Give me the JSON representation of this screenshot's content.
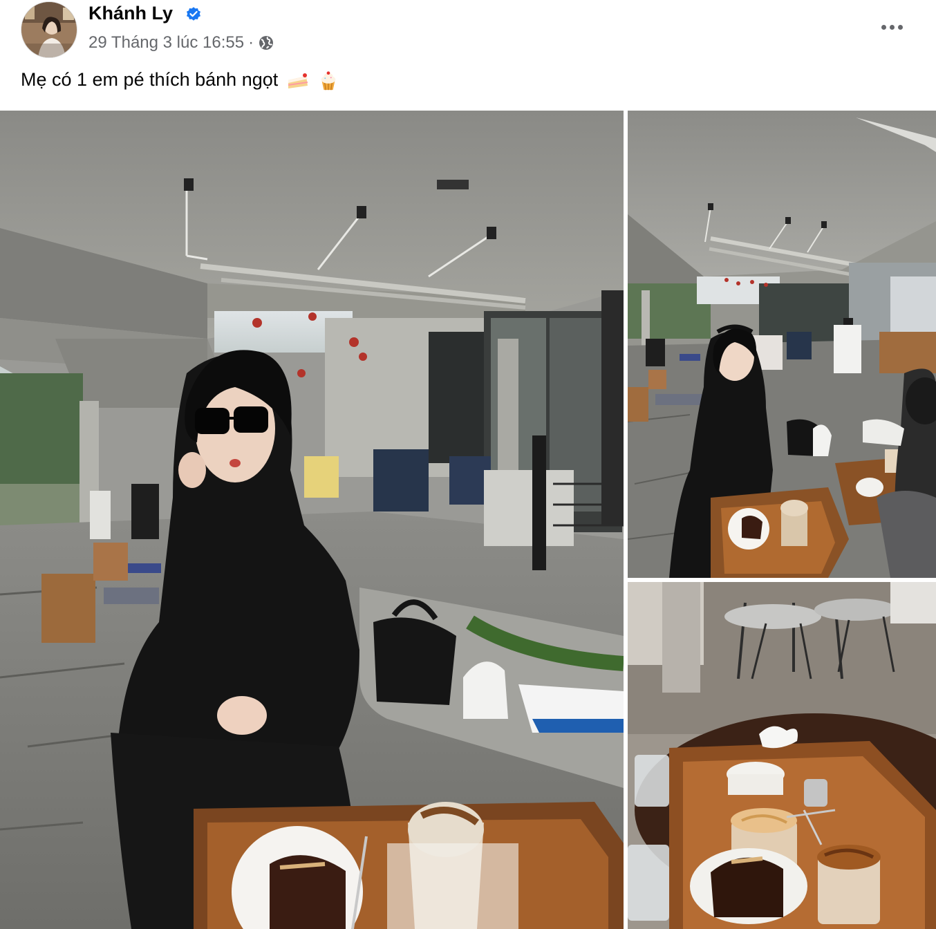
{
  "post": {
    "author": {
      "name": "Khánh Ly",
      "verified": true,
      "avatar_icon": "profile-photo"
    },
    "timestamp": "29 Tháng 3 lúc 16:55",
    "separator": "·",
    "audience_icon": "globe-icon",
    "text": "Mẹ có 1 em pé thích bánh ngọt",
    "emojis": [
      "cake-slice-emoji",
      "cupcake-emoji"
    ],
    "more_icon": "more-options-icon"
  },
  "gallery": {
    "photos": [
      {
        "id": "photo-1",
        "subject": "woman in black dress eating cake at outdoor cafe"
      },
      {
        "id": "photo-2",
        "subject": "woman sitting at table with tray of cake and coffee"
      },
      {
        "id": "photo-3",
        "subject": "tray with cake, drinks and glasses of water"
      }
    ]
  },
  "colors": {
    "text_primary": "#050505",
    "text_secondary": "#65676b",
    "verified_blue": "#1877f2"
  }
}
